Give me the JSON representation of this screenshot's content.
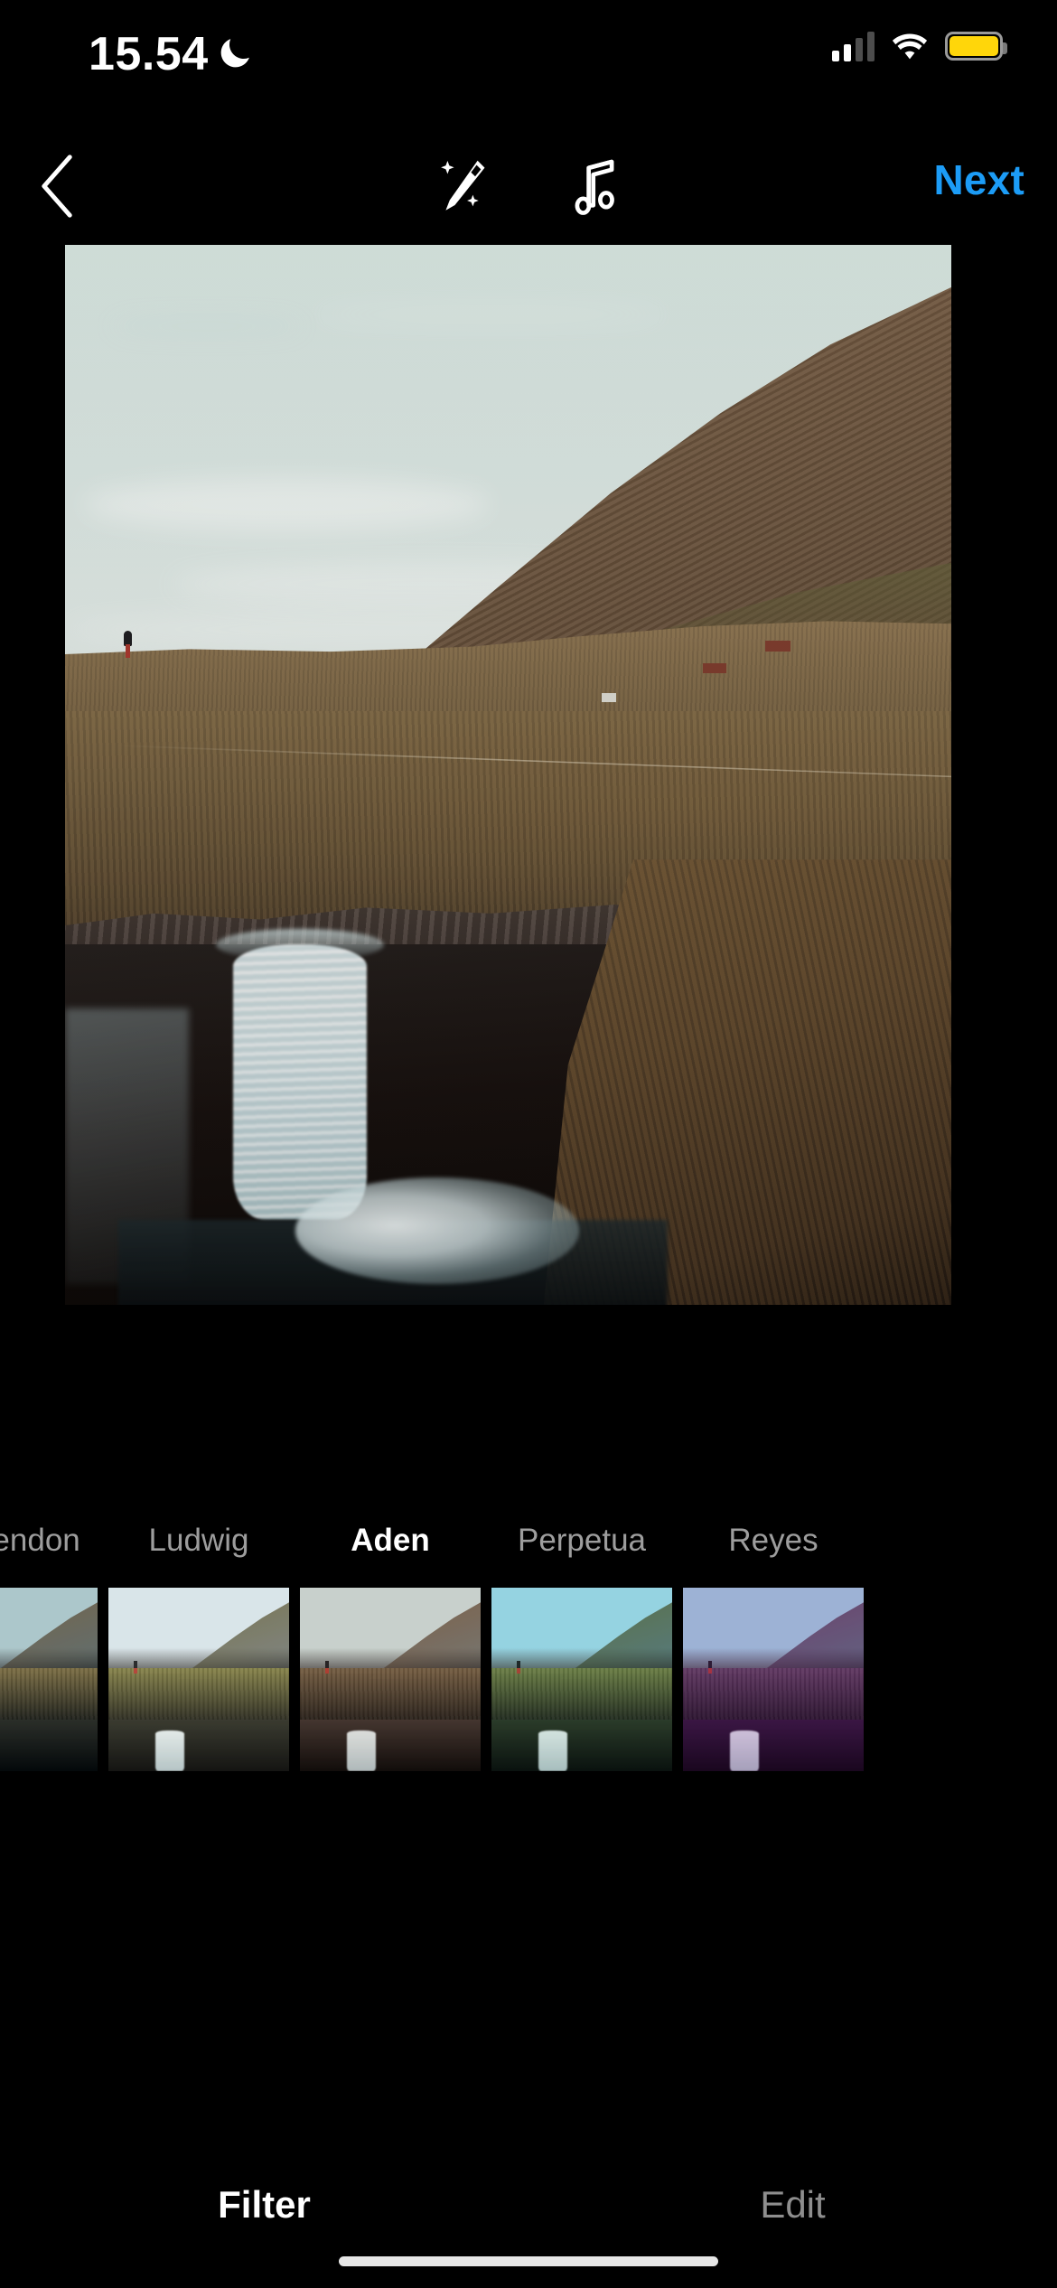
{
  "status_bar": {
    "time": "15.54",
    "dnd_icon": "moon-icon",
    "cellular_icon": "cellular-bars-icon",
    "wifi_icon": "wifi-icon",
    "battery_icon": "battery-icon",
    "battery_color": "#FFD60A"
  },
  "nav_bar": {
    "back_icon": "chevron-left-icon",
    "magic_icon": "magic-wand-icon",
    "music_icon": "music-note-icon",
    "next_label": "Next",
    "next_color": "#1C9CF6"
  },
  "photo": {
    "alt_name": "waterfall-landscape-photo",
    "sky_color": "#D6E4E1",
    "grass_color": "#6E5A3C",
    "rock_color": "#463B36",
    "water_color": "#E4F0F1"
  },
  "filter_carousel": {
    "selected": "Aden",
    "filters": [
      {
        "name": "Clarendon",
        "sky": "#bcd4d6",
        "mountain": "#7d6445",
        "grass": "#85703f",
        "cliff": "#2c2a22",
        "grade": "rgba(40,90,110,0.10)"
      },
      {
        "name": "Ludwig",
        "sky": "#dbe8ef",
        "mountain": "#6f6a42",
        "grass": "#7e7a3d",
        "cliff": "#2a2b21",
        "grade": "rgba(210,210,190,0.10)"
      },
      {
        "name": "Aden",
        "sky": "#d0dfdc",
        "mountain": "#7a5e44",
        "grass": "#6f5a3d",
        "cliff": "#3a2f2a",
        "grade": "rgba(150,110,90,0.12)"
      },
      {
        "name": "Perpetua",
        "sky": "#9fdcf0",
        "mountain": "#5d6b3e",
        "grass": "#6d7a3c",
        "cliff": "#26301f",
        "grade": "rgba(80,150,120,0.12)"
      },
      {
        "name": "Reyes",
        "sky": "#a8dcea",
        "mountain": "#6a4a62",
        "grass": "#5a3f55",
        "cliff": "#2a1430",
        "grade": "rgba(120,30,140,0.22)"
      }
    ]
  },
  "tabs": [
    {
      "label": "Filter",
      "active": true
    },
    {
      "label": "Edit",
      "active": false
    }
  ],
  "home_indicator": "home-indicator"
}
